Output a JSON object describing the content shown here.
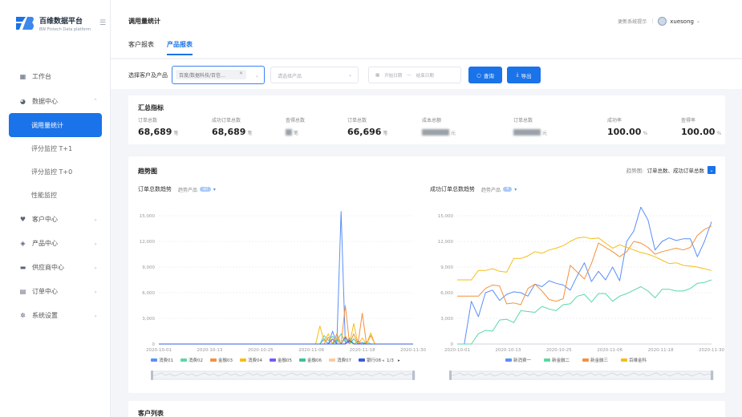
{
  "brand": {
    "title": "百维数据平台",
    "subtitle": "BW Fintech Data platform",
    "collapse_icon": "menu-fold-icon"
  },
  "nav": [
    {
      "key": "workbench",
      "label": "工作台",
      "icon": "dashboard-icon"
    },
    {
      "key": "data",
      "label": "数据中心",
      "icon": "pie-icon",
      "open": true,
      "children": [
        {
          "label": "调用量统计",
          "active": true
        },
        {
          "label": "评分监控 T+1"
        },
        {
          "label": "评分监控 T+0"
        },
        {
          "label": "性能监控"
        }
      ]
    },
    {
      "key": "customer",
      "label": "客户中心",
      "icon": "heart-icon"
    },
    {
      "key": "product",
      "label": "产品中心",
      "icon": "cube-icon"
    },
    {
      "key": "supplier",
      "label": "供应商中心",
      "icon": "truck-icon"
    },
    {
      "key": "order",
      "label": "订单中心",
      "icon": "file-icon"
    },
    {
      "key": "settings",
      "label": "系统设置",
      "icon": "gear-icon"
    }
  ],
  "header": {
    "title": "调用量统计",
    "update_log": "更新系统提示",
    "username": "xuesong"
  },
  "tabs": [
    {
      "label": "客户报表",
      "active": false
    },
    {
      "label": "产品报表",
      "active": true
    }
  ],
  "filter": {
    "label": "选择客户及产品",
    "chip": "百度/数据科技/百信…",
    "product_placeholder": "请选择产品",
    "start_placeholder": "开始日期",
    "end_placeholder": "结束日期",
    "dash": "—",
    "query_label": "查询",
    "export_label": "导出"
  },
  "summary": {
    "title": "汇总指标",
    "metrics": [
      {
        "label": "订单总数",
        "value": "68,689",
        "unit": "笔"
      },
      {
        "label": "成功订单总数",
        "value": "68,689",
        "unit": "笔"
      },
      {
        "label": "查得总数",
        "value": "",
        "unit": "笔",
        "blurred": true
      },
      {
        "label": "订单总数",
        "value": "66,696",
        "unit": "笔"
      },
      {
        "label": "成本总额",
        "value": "",
        "unit": "元",
        "blurred": true
      },
      {
        "label": "订单总数",
        "value": "",
        "unit": "元",
        "blurred": true
      },
      {
        "label": "成功率",
        "value": "100.00",
        "unit": "%"
      },
      {
        "label": "查得率",
        "value": "100.00",
        "unit": "%"
      }
    ]
  },
  "trend": {
    "title": "趋势图",
    "selector_label": "趋势图:",
    "selector_value": "订单总数、成功订单总数"
  },
  "chart_data": [
    {
      "type": "line",
      "title": "订单总数趋势",
      "filter_label": "趋势产品",
      "filter_badge": "all",
      "x_ticks": [
        "2020-10-01",
        "2020-10-13",
        "2020-10-25",
        "2020-11-06",
        "2020-11-18",
        "2020-11-30"
      ],
      "ylim": [
        0,
        15000
      ],
      "y_ticks": [
        "0",
        "3,000",
        "6,000",
        "9,000",
        "12,000",
        "15,000"
      ],
      "legend_page": "1/3",
      "series": [
        {
          "name": "消费01",
          "color": "#5b8ff9",
          "values": [
            0,
            0,
            0,
            0,
            0,
            0,
            0,
            0,
            0,
            0,
            0,
            0,
            0,
            0,
            0,
            0,
            0,
            0,
            0,
            0,
            0,
            0,
            0,
            0,
            0,
            0,
            0,
            0,
            0,
            0,
            0,
            0,
            0,
            0,
            0,
            0,
            0,
            0,
            0,
            600,
            0,
            1500,
            0,
            15500,
            0,
            600,
            0,
            0,
            200,
            0,
            0,
            0,
            0,
            0,
            0,
            0,
            0,
            0,
            0,
            0,
            0
          ]
        },
        {
          "name": "消费02",
          "color": "#5ad8a6",
          "values": [
            0,
            0,
            0,
            0,
            0,
            0,
            0,
            0,
            0,
            0,
            0,
            0,
            0,
            0,
            0,
            0,
            0,
            0,
            0,
            0,
            0,
            0,
            0,
            0,
            0,
            0,
            0,
            0,
            0,
            0,
            0,
            0,
            0,
            0,
            0,
            0,
            0,
            0,
            0,
            1000,
            400,
            900,
            300,
            1200,
            200,
            700,
            0,
            500,
            0,
            300,
            0,
            0,
            0,
            0,
            0,
            0,
            0,
            0,
            0,
            0,
            0
          ]
        },
        {
          "name": "金融03",
          "color": "#f6903d",
          "values": [
            0,
            0,
            0,
            0,
            0,
            0,
            0,
            0,
            0,
            0,
            0,
            0,
            0,
            0,
            0,
            0,
            0,
            0,
            0,
            0,
            0,
            0,
            0,
            0,
            0,
            0,
            0,
            0,
            0,
            0,
            0,
            0,
            0,
            0,
            0,
            0,
            0,
            0,
            0,
            0,
            800,
            0,
            1200,
            0,
            4500,
            0,
            1200,
            0,
            3600,
            0,
            1000,
            0,
            0,
            0,
            0,
            0,
            0,
            0,
            0,
            0,
            0
          ]
        },
        {
          "name": "消费04",
          "color": "#f6bd16",
          "values": [
            0,
            0,
            0,
            0,
            0,
            0,
            0,
            0,
            0,
            0,
            0,
            0,
            0,
            0,
            0,
            0,
            0,
            0,
            0,
            0,
            0,
            0,
            0,
            0,
            0,
            0,
            0,
            0,
            0,
            0,
            0,
            0,
            0,
            0,
            0,
            0,
            0,
            0,
            2100,
            300,
            1200,
            0,
            800,
            0,
            1000,
            0,
            2400,
            0,
            700,
            0,
            1300,
            0,
            0,
            0,
            0,
            0,
            0,
            0,
            0,
            0,
            0
          ]
        },
        {
          "name": "金融05",
          "color": "#6f5ef9",
          "values": [
            0,
            0,
            0,
            0,
            0,
            0,
            0,
            0,
            0,
            0,
            0,
            0,
            0,
            0,
            0,
            0,
            0,
            0,
            0,
            0,
            0,
            0,
            0,
            0,
            0,
            0,
            0,
            0,
            0,
            0,
            0,
            0,
            0,
            0,
            0,
            0,
            0,
            0,
            0,
            0,
            0,
            600,
            0,
            0,
            800,
            0,
            0,
            400,
            0,
            0,
            0,
            0,
            0,
            0,
            0,
            0,
            0,
            0,
            0,
            0,
            0
          ]
        },
        {
          "name": "金融06",
          "color": "#3bc48e",
          "values": [
            0,
            0,
            0,
            0,
            0,
            0,
            0,
            0,
            0,
            0,
            0,
            0,
            0,
            0,
            0,
            0,
            0,
            0,
            0,
            0,
            0,
            0,
            0,
            0,
            0,
            0,
            0,
            0,
            0,
            0,
            0,
            0,
            0,
            0,
            0,
            0,
            0,
            0,
            0,
            0,
            0,
            0,
            500,
            0,
            0,
            0,
            600,
            0,
            0,
            0,
            0,
            0,
            0,
            0,
            0,
            0,
            0,
            0,
            0,
            0,
            0
          ]
        },
        {
          "name": "消费07",
          "color": "#ffc9a0",
          "values": [
            0,
            0,
            0,
            0,
            0,
            0,
            0,
            0,
            0,
            0,
            0,
            0,
            0,
            0,
            0,
            0,
            0,
            0,
            0,
            0,
            0,
            0,
            0,
            0,
            0,
            0,
            0,
            0,
            0,
            0,
            0,
            0,
            0,
            0,
            0,
            0,
            0,
            0,
            0,
            0,
            0,
            0,
            0,
            300,
            0,
            0,
            0,
            500,
            0,
            0,
            0,
            0,
            0,
            0,
            0,
            0,
            0,
            0,
            0,
            0,
            0
          ]
        },
        {
          "name": "银行08",
          "color": "#3a5bd9",
          "values": [
            0,
            0,
            0,
            0,
            0,
            0,
            0,
            0,
            0,
            0,
            0,
            0,
            0,
            0,
            0,
            0,
            0,
            0,
            0,
            0,
            0,
            0,
            0,
            0,
            0,
            0,
            0,
            0,
            0,
            0,
            0,
            0,
            0,
            0,
            0,
            0,
            0,
            0,
            0,
            0,
            0,
            0,
            0,
            0,
            0,
            400,
            0,
            0,
            0,
            0,
            0,
            0,
            0,
            0,
            0,
            0,
            0,
            0,
            0,
            0,
            0
          ]
        }
      ]
    },
    {
      "type": "line",
      "title": "成功订单总数趋势",
      "filter_label": "趋势产品",
      "filter_badge": "4",
      "x_ticks": [
        "2020-10-01",
        "2020-10-13",
        "2020-10-25",
        "2020-11-06",
        "2020-11-18",
        "2020-11-30"
      ],
      "ylim": [
        0,
        15000
      ],
      "y_ticks": [
        "0",
        "3,000",
        "6,000",
        "9,000",
        "12,000",
        "15,000"
      ],
      "series": [
        {
          "name": "新消费一",
          "color": "#5b8ff9",
          "values": [
            0,
            0,
            5000,
            3200,
            6000,
            6300,
            5100,
            5800,
            6100,
            6000,
            5600,
            7000,
            6700,
            7400,
            7100,
            6900,
            6300,
            8000,
            9500,
            7300,
            8500,
            7500,
            9000,
            7400,
            12000,
            13200,
            16000,
            14500,
            11000,
            12000,
            12400,
            12100,
            12300,
            12300,
            10200,
            12000,
            14300
          ]
        },
        {
          "name": "新金融二",
          "color": "#5ad8a6",
          "values": [
            0,
            0,
            0,
            1200,
            1600,
            1500,
            2800,
            2900,
            2500,
            3900,
            3800,
            3700,
            4400,
            4100,
            3900,
            4600,
            4700,
            5600,
            5800,
            4900,
            5900,
            5900,
            5000,
            5600,
            5900,
            6300,
            6700,
            6200,
            5400,
            6400,
            6400,
            6200,
            6200,
            6500,
            7100,
            7200,
            7500
          ]
        },
        {
          "name": "新金融三",
          "color": "#f6903d",
          "values": [
            5600,
            5600,
            5600,
            5600,
            6500,
            6900,
            6800,
            4700,
            4800,
            4600,
            6500,
            7000,
            6200,
            5200,
            5000,
            5300,
            9200,
            8400,
            7600,
            9400,
            11800,
            11300,
            10800,
            10200,
            10800,
            12000,
            11800,
            11300,
            10500,
            10800,
            11000,
            11200,
            11000,
            11300,
            12700,
            13400,
            13800
          ]
        },
        {
          "name": "百维金科",
          "color": "#f6bd16",
          "values": [
            7500,
            7500,
            7500,
            8600,
            8600,
            8800,
            8500,
            8400,
            10000,
            10000,
            10300,
            10800,
            10600,
            11000,
            11200,
            11500,
            12000,
            12400,
            12500,
            12300,
            12400,
            11800,
            11200,
            11600,
            11300,
            11000,
            10700,
            10500,
            10200,
            9800,
            9400,
            9500,
            9200,
            9100,
            9000,
            8800,
            8600
          ]
        }
      ]
    }
  ],
  "customer_list": {
    "title": "客户列表"
  }
}
